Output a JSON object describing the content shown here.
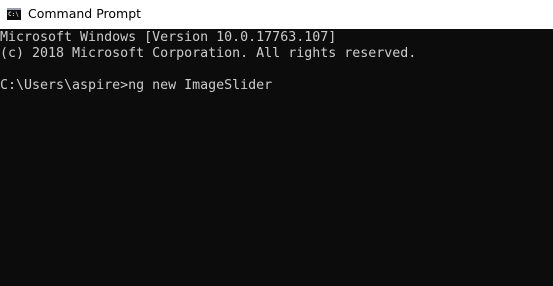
{
  "window": {
    "title": "Command Prompt",
    "icon": "command-prompt-icon",
    "icon_glyph": "C:\\"
  },
  "console": {
    "background_color": "#0c0c0c",
    "text_color": "#cccccc",
    "lines": [
      "Microsoft Windows [Version 10.0.17763.107]",
      "(c) 2018 Microsoft Corporation. All rights reserved.",
      "",
      "C:\\Users\\aspire>ng new ImageSlider"
    ]
  }
}
